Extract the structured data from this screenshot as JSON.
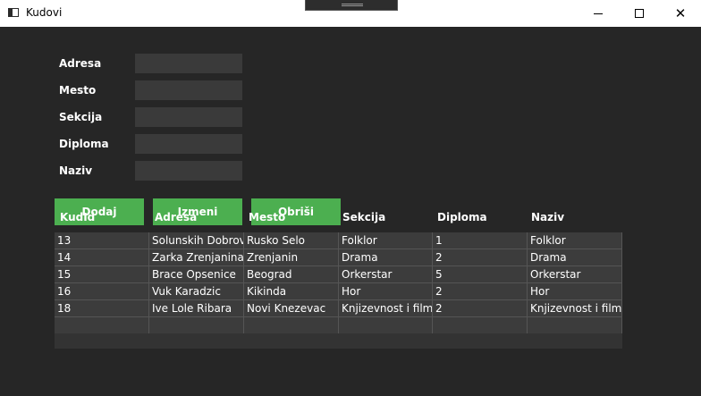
{
  "window": {
    "title": "Kudovi"
  },
  "form": {
    "fields": [
      {
        "label": "Adresa",
        "value": ""
      },
      {
        "label": "Mesto",
        "value": ""
      },
      {
        "label": "Sekcija",
        "value": ""
      },
      {
        "label": "Diploma",
        "value": ""
      },
      {
        "label": "Naziv",
        "value": ""
      }
    ]
  },
  "buttons": {
    "add": "Dodaj",
    "edit": "Izmeni",
    "delete": "Obriši"
  },
  "colors": {
    "button": "#4caf50",
    "background": "#262626",
    "input": "#3a3a3a"
  },
  "table": {
    "columns": [
      "KudId",
      "Adresa",
      "Mesto",
      "Sekcija",
      "Diploma",
      "Naziv"
    ],
    "rows": [
      [
        "13",
        "Solunskih Dobrovoljaca",
        "Rusko Selo",
        "Folklor",
        "1",
        "Folklor"
      ],
      [
        "14",
        "Zarka Zrenjanina",
        "Zrenjanin",
        "Drama",
        "2",
        "Drama"
      ],
      [
        "15",
        "Brace Opsenice",
        "Beograd",
        "Orkerstar",
        "5",
        "Orkerstar"
      ],
      [
        "16",
        "Vuk Karadzic",
        "Kikinda",
        "Hor",
        "2",
        "Hor"
      ],
      [
        "18",
        "Ive Lole Ribara",
        "Novi Knezevac",
        "Knjizevnost i film",
        "2",
        "Knjizevnost i film"
      ]
    ]
  }
}
